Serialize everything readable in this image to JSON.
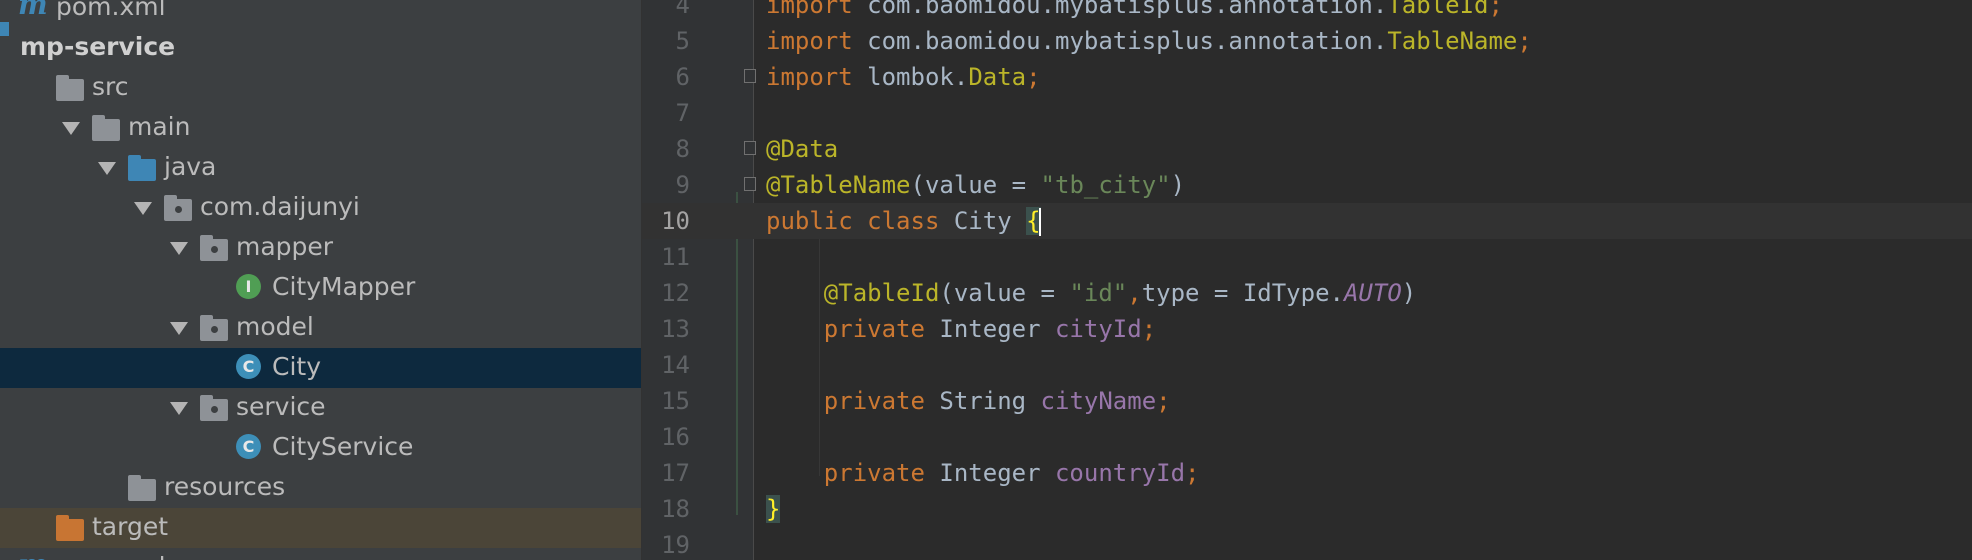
{
  "tree": {
    "items": [
      {
        "label": "pom.xml",
        "icon": "maven-icon",
        "indent": 0,
        "arrow": false
      },
      {
        "label": "mp-service",
        "icon": "module-folder-icon",
        "indent": 0,
        "arrow": false,
        "bold": true
      },
      {
        "label": "src",
        "icon": "folder-icon",
        "indent": 1,
        "arrow": false
      },
      {
        "label": "main",
        "icon": "folder-icon",
        "indent": 2,
        "arrow": true
      },
      {
        "label": "java",
        "icon": "source-folder-icon",
        "indent": 3,
        "arrow": true
      },
      {
        "label": "com.daijunyi",
        "icon": "package-icon",
        "indent": 4,
        "arrow": true
      },
      {
        "label": "mapper",
        "icon": "package-icon",
        "indent": 5,
        "arrow": true
      },
      {
        "label": "CityMapper",
        "icon": "interface-icon",
        "indent": 6,
        "arrow": false,
        "badge": "I"
      },
      {
        "label": "model",
        "icon": "package-icon",
        "indent": 5,
        "arrow": true
      },
      {
        "label": "City",
        "icon": "class-icon",
        "indent": 6,
        "arrow": false,
        "badge": "C",
        "selected": true
      },
      {
        "label": "service",
        "icon": "package-icon",
        "indent": 5,
        "arrow": true
      },
      {
        "label": "CityService",
        "icon": "class-icon",
        "indent": 6,
        "arrow": false,
        "badge": "C"
      },
      {
        "label": "resources",
        "icon": "folder-icon",
        "indent": 3,
        "arrow": false
      },
      {
        "label": "target",
        "icon": "excluded-folder-icon",
        "indent": 1,
        "arrow": false,
        "excluded": true
      },
      {
        "label": "pom.xml",
        "icon": "maven-icon",
        "indent": 0,
        "arrow": false
      }
    ]
  },
  "editor": {
    "current_line": "10",
    "lines": [
      {
        "n": "4",
        "tokens": [
          [
            "kw",
            "import "
          ],
          [
            "",
            "com.baomidou.mybatisplus.annotation."
          ],
          [
            "ann",
            "TableId"
          ],
          [
            "kw",
            ";"
          ]
        ]
      },
      {
        "n": "5",
        "tokens": [
          [
            "kw",
            "import "
          ],
          [
            "",
            "com.baomidou.mybatisplus.annotation."
          ],
          [
            "ann",
            "TableName"
          ],
          [
            "kw",
            ";"
          ]
        ]
      },
      {
        "n": "6",
        "tokens": [
          [
            "kw",
            "import "
          ],
          [
            "",
            "lombok."
          ],
          [
            "ann",
            "Data"
          ],
          [
            "kw",
            ";"
          ]
        ]
      },
      {
        "n": "7",
        "tokens": []
      },
      {
        "n": "8",
        "tokens": [
          [
            "ann",
            "@Data"
          ]
        ]
      },
      {
        "n": "9",
        "tokens": [
          [
            "ann",
            "@TableName"
          ],
          [
            "",
            "(value = "
          ],
          [
            "str",
            "\"tb_city\""
          ],
          [
            "",
            ")"
          ]
        ]
      },
      {
        "n": "10",
        "tokens": [
          [
            "kw",
            "public class "
          ],
          [
            "",
            "City "
          ],
          [
            "brace",
            "{"
          ]
        ]
      },
      {
        "n": "11",
        "tokens": []
      },
      {
        "n": "12",
        "tokens": [
          [
            "",
            "    "
          ],
          [
            "ann",
            "@TableId"
          ],
          [
            "",
            "(value = "
          ],
          [
            "str",
            "\"id\""
          ],
          [
            "kw",
            ","
          ],
          [
            "",
            "type = IdType."
          ],
          [
            "cst",
            "AUTO"
          ],
          [
            "",
            ")"
          ]
        ]
      },
      {
        "n": "13",
        "tokens": [
          [
            "",
            "    "
          ],
          [
            "kw",
            "private "
          ],
          [
            "",
            "Integer "
          ],
          [
            "fld",
            "cityId"
          ],
          [
            "kw",
            ";"
          ]
        ]
      },
      {
        "n": "14",
        "tokens": []
      },
      {
        "n": "15",
        "tokens": [
          [
            "",
            "    "
          ],
          [
            "kw",
            "private "
          ],
          [
            "",
            "String "
          ],
          [
            "fld",
            "cityName"
          ],
          [
            "kw",
            ";"
          ]
        ]
      },
      {
        "n": "16",
        "tokens": []
      },
      {
        "n": "17",
        "tokens": [
          [
            "",
            "    "
          ],
          [
            "kw",
            "private "
          ],
          [
            "",
            "Integer "
          ],
          [
            "fld",
            "countryId"
          ],
          [
            "kw",
            ";"
          ]
        ]
      },
      {
        "n": "18",
        "tokens": [
          [
            "brace",
            "}"
          ]
        ]
      },
      {
        "n": "19",
        "tokens": []
      }
    ]
  },
  "colors": {
    "tree_bg": "#3c3f41",
    "editor_bg": "#2b2b2b",
    "selection": "#0d293e",
    "keyword": "#cc7832",
    "annotation": "#bbb529",
    "string": "#6a8759",
    "field": "#9876aa"
  }
}
